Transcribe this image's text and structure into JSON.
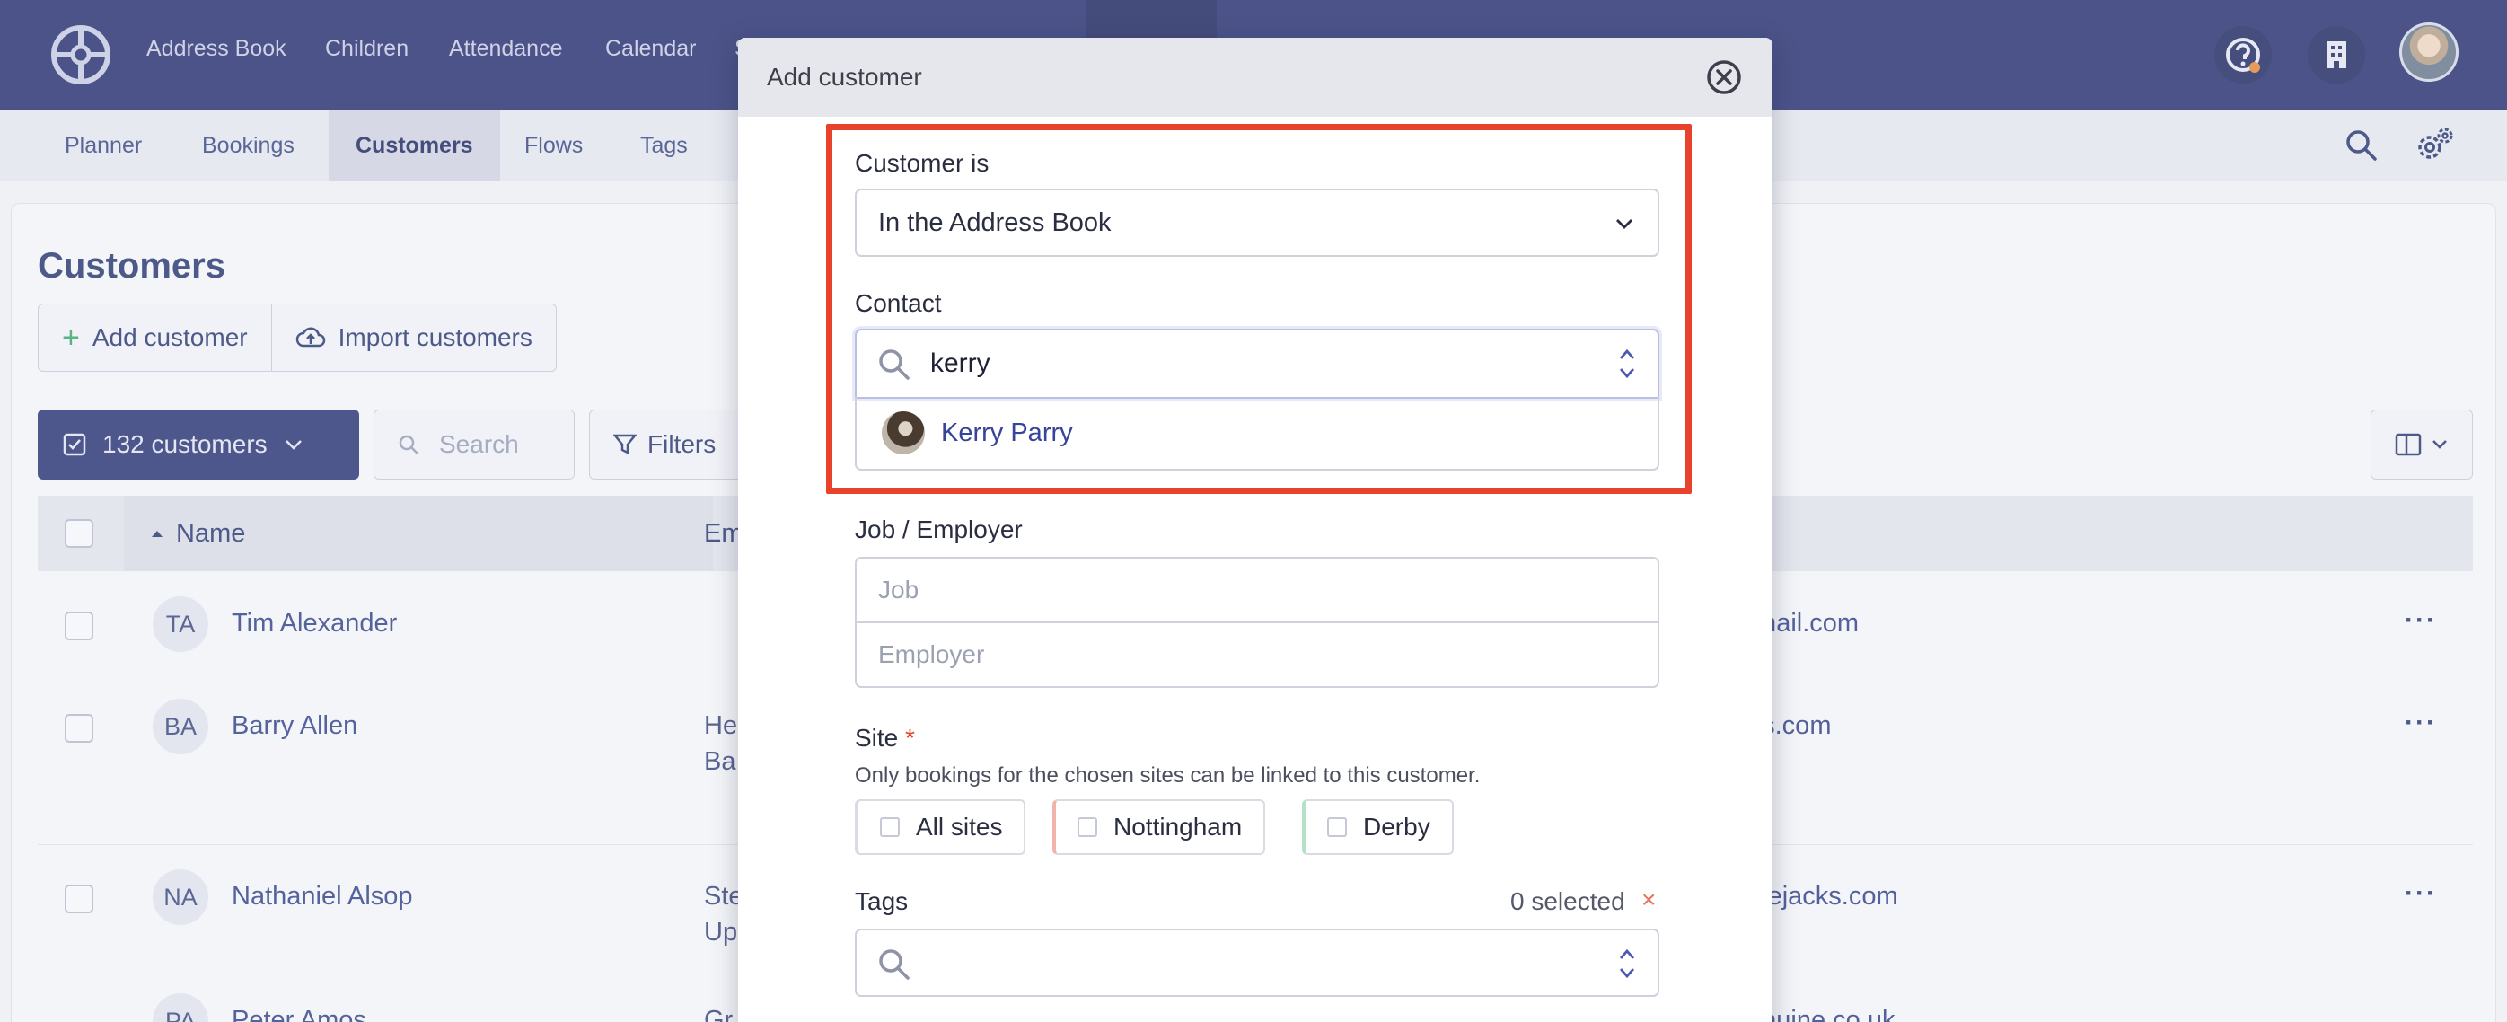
{
  "topnav": {
    "items": [
      "Address Book",
      "Children",
      "Attendance",
      "Calendar",
      "S"
    ]
  },
  "subnav": {
    "items": [
      "Planner",
      "Bookings",
      "Customers",
      "Flows",
      "Tags"
    ],
    "active": "Customers"
  },
  "main": {
    "title": "Customers",
    "add_customer_label": "Add customer",
    "import_customers_label": "Import customers",
    "count_label": "132 customers",
    "search_placeholder": "Search",
    "filters_label": "Filters",
    "columns": {
      "name": "Name",
      "email": "Em"
    },
    "rows": [
      {
        "initials": "TA",
        "name": "Tim Alexander",
        "job": "",
        "job2": "",
        "email": "tmail.com"
      },
      {
        "initials": "BA",
        "name": "Barry Allen",
        "job": "He",
        "job2": "Ba",
        "email": "gs.com"
      },
      {
        "initials": "NA",
        "name": "Nathaniel Alsop",
        "job": "Ste",
        "job2": "Up",
        "email": "plejacks.com"
      },
      {
        "initials": "PA",
        "name": "Peter Amos",
        "job": "Gr",
        "job2": "",
        "email": "enuine.co.uk"
      }
    ]
  },
  "modal": {
    "title": "Add customer",
    "customer_is_label": "Customer is",
    "customer_is_value": "In the Address Book",
    "contact_label": "Contact",
    "contact_value": "kerry",
    "contact_option": "Kerry Parry",
    "job_employer_label": "Job / Employer",
    "job_placeholder": "Job",
    "employer_placeholder": "Employer",
    "site_label": "Site",
    "site_required": "*",
    "site_hint": "Only bookings for the chosen sites can be linked to this customer.",
    "sites": [
      {
        "label": "All sites",
        "color": "#d8dbe3"
      },
      {
        "label": "Nottingham",
        "color": "#f3b3ad"
      },
      {
        "label": "Derby",
        "color": "#b4e0c6"
      }
    ],
    "tags_label": "Tags",
    "tags_selected": "0 selected",
    "tags_clear": "×"
  },
  "colors": {
    "nav": "#2a3272",
    "highlight": "#e8422c",
    "accent_green": "#3aa66a"
  }
}
